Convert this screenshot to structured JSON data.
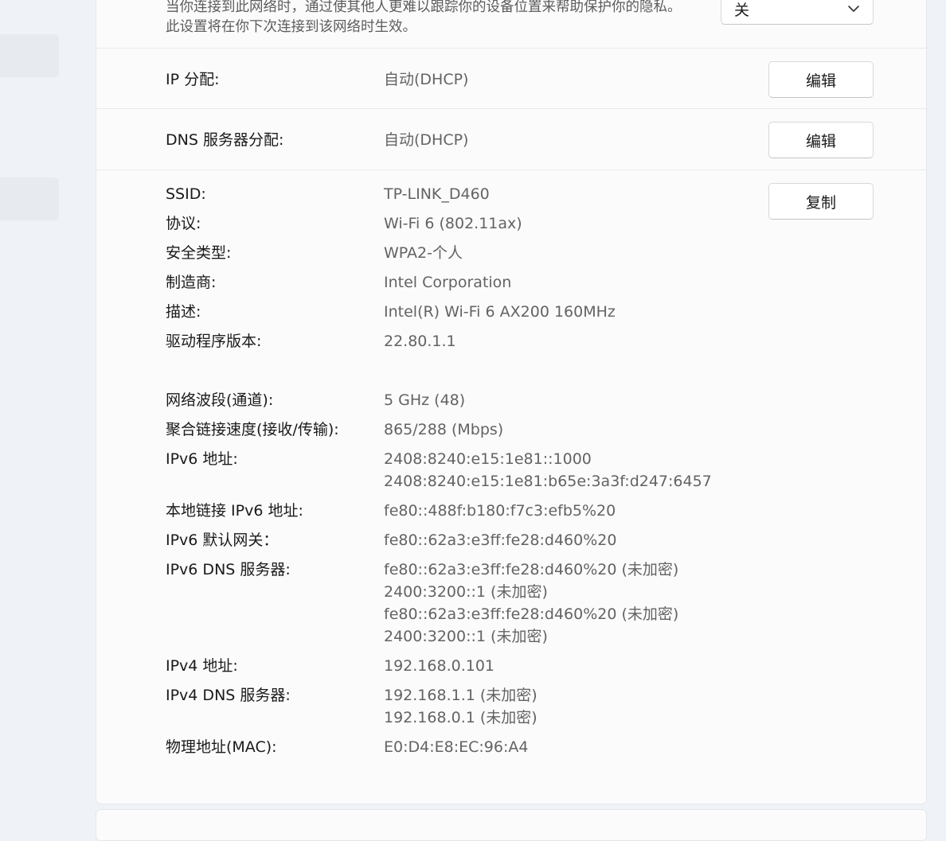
{
  "privacy_setting": {
    "description_line1": "当你连接到此网络时，通过使其他人更难以跟踪你的设备位置来帮助保护你的隐私。",
    "description_line2": "此设置将在你下次连接到该网络时生效。",
    "dropdown_value": "关",
    "dropdown_icon": "chevron-down-icon"
  },
  "ip_assignment": {
    "label": "IP 分配:",
    "value": "自动(DHCP)",
    "button": "编辑"
  },
  "dns_assignment": {
    "label": "DNS 服务器分配:",
    "value": "自动(DHCP)",
    "button": "编辑"
  },
  "copy_button": "复制",
  "properties": [
    {
      "label": "SSID:",
      "values": [
        "TP-LINK_D460"
      ]
    },
    {
      "label": "协议:",
      "values": [
        "Wi-Fi 6 (802.11ax)"
      ]
    },
    {
      "label": "安全类型:",
      "values": [
        "WPA2-个人"
      ]
    },
    {
      "label": "制造商:",
      "values": [
        "Intel Corporation"
      ]
    },
    {
      "label": "描述:",
      "values": [
        "Intel(R) Wi-Fi 6 AX200 160MHz"
      ]
    },
    {
      "label": "驱动程序版本:",
      "values": [
        "22.80.1.1"
      ]
    },
    {
      "label": "网络波段(通道):",
      "values": [
        "5 GHz (48)"
      ]
    },
    {
      "label": "聚合链接速度(接收/传输):",
      "values": [
        "865/288 (Mbps)"
      ]
    },
    {
      "label": "IPv6 地址:",
      "values": [
        "2408:8240:e15:1e81::1000",
        "2408:8240:e15:1e81:b65e:3a3f:d247:6457"
      ]
    },
    {
      "label": "本地链接 IPv6 地址:",
      "values": [
        "fe80::488f:b180:f7c3:efb5%20"
      ]
    },
    {
      "label": "IPv6 默认网关：",
      "values": [
        "fe80::62a3:e3ff:fe28:d460%20"
      ]
    },
    {
      "label": "IPv6 DNS 服务器:",
      "values": [
        "fe80::62a3:e3ff:fe28:d460%20 (未加密)",
        "2400:3200::1 (未加密)",
        "fe80::62a3:e3ff:fe28:d460%20 (未加密)",
        "2400:3200::1 (未加密)"
      ]
    },
    {
      "label": "IPv4 地址:",
      "values": [
        "192.168.0.101"
      ]
    },
    {
      "label": "IPv4 DNS 服务器:",
      "values": [
        "192.168.1.1 (未加密)",
        "192.168.0.1 (未加密)"
      ]
    },
    {
      "label": "物理地址(MAC):",
      "values": [
        "E0:D4:E8:EC:96:A4"
      ]
    }
  ]
}
